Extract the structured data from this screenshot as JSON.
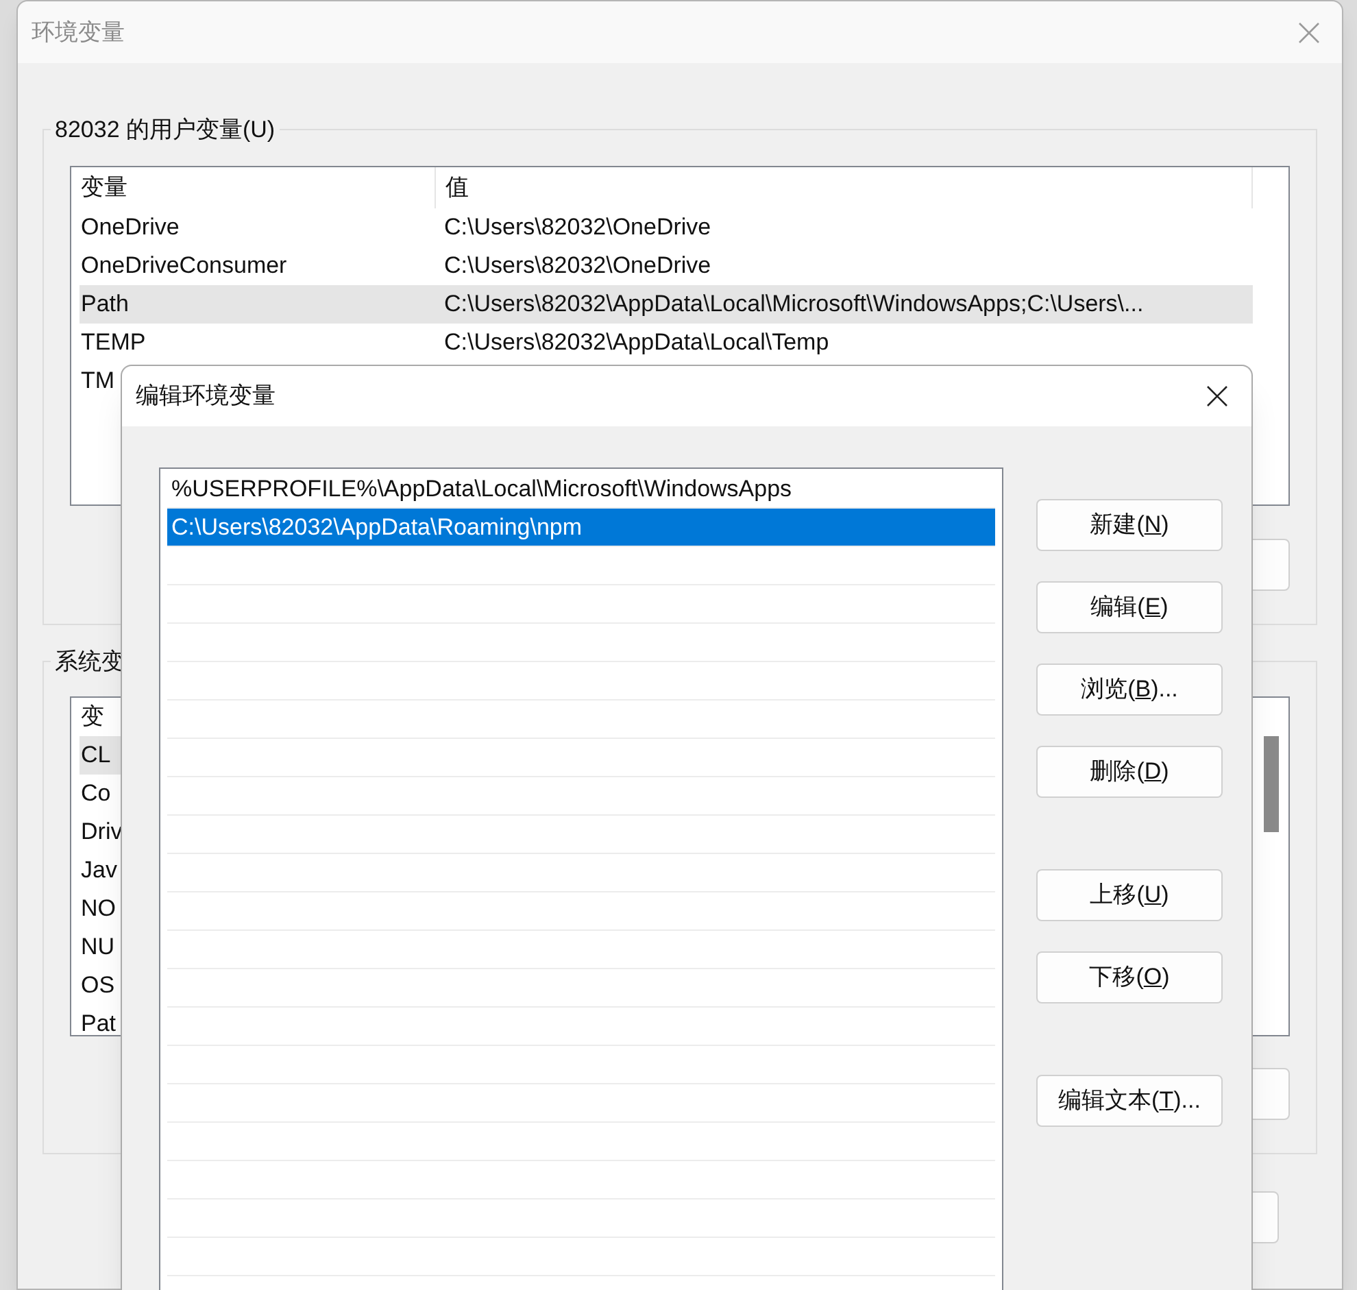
{
  "main_window": {
    "title": "环境变量",
    "user_vars": {
      "label": "82032 的用户变量(U)",
      "columns": [
        "变量",
        "值"
      ],
      "rows": [
        {
          "name": "OneDrive",
          "value": "C:\\Users\\82032\\OneDrive",
          "selected": false
        },
        {
          "name": "OneDriveConsumer",
          "value": "C:\\Users\\82032\\OneDrive",
          "selected": false
        },
        {
          "name": "Path",
          "value": "C:\\Users\\82032\\AppData\\Local\\Microsoft\\WindowsApps;C:\\Users\\...",
          "selected": true
        },
        {
          "name": "TEMP",
          "value": "C:\\Users\\82032\\AppData\\Local\\Temp",
          "selected": false
        },
        {
          "name": "TM",
          "value": "",
          "selected": false
        }
      ]
    },
    "system_vars": {
      "label": "系统变",
      "columns": [
        "变"
      ],
      "rows": [
        {
          "name": "CL",
          "selected": true
        },
        {
          "name": "Co",
          "selected": false
        },
        {
          "name": "Driv",
          "selected": false
        },
        {
          "name": "Jav",
          "selected": false
        },
        {
          "name": "NO",
          "selected": false
        },
        {
          "name": "NU",
          "selected": false
        },
        {
          "name": "OS",
          "selected": false
        },
        {
          "name": "Pat",
          "selected": false
        }
      ]
    }
  },
  "edit_dialog": {
    "title": "编辑环境变量",
    "entries": [
      {
        "text": "%USERPROFILE%\\AppData\\Local\\Microsoft\\WindowsApps",
        "selected": false
      },
      {
        "text": "C:\\Users\\82032\\AppData\\Roaming\\npm",
        "selected": true
      }
    ],
    "buttons": [
      {
        "label_parts": [
          "新建(",
          "N",
          ")"
        ]
      },
      {
        "label_parts": [
          "编辑(",
          "E",
          ")"
        ]
      },
      {
        "label_parts": [
          "浏览(",
          "B",
          ")..."
        ]
      },
      {
        "label_parts": [
          "删除(",
          "D",
          ")"
        ]
      },
      {
        "label_parts": [
          "上移(",
          "U",
          ")"
        ]
      },
      {
        "label_parts": [
          "下移(",
          "O",
          ")"
        ]
      },
      {
        "label_parts": [
          "编辑文本(",
          "T",
          ")..."
        ]
      }
    ]
  }
}
